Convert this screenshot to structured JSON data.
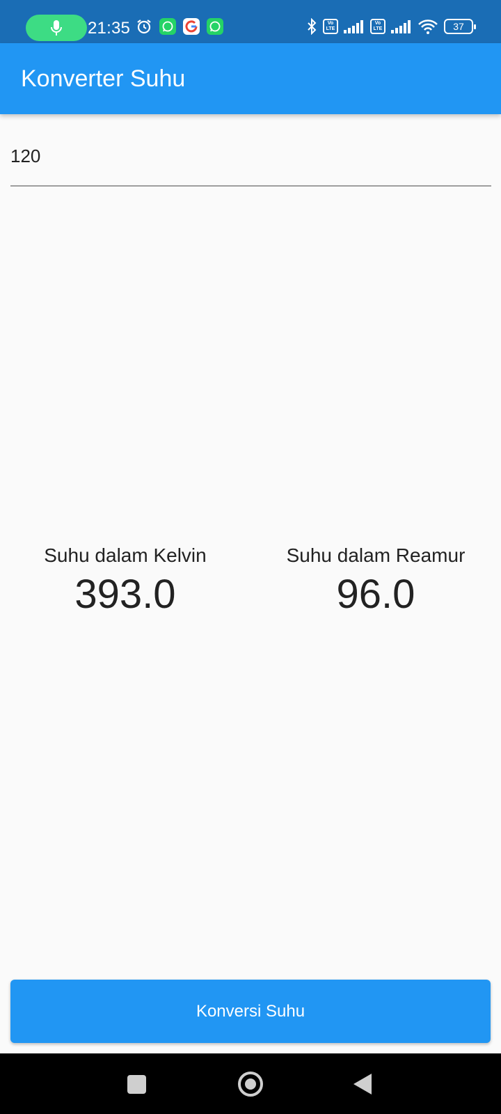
{
  "status_bar": {
    "time": "21:35",
    "battery_level": "37",
    "volte_label": "Vo LTE",
    "icons": [
      "mic-icon",
      "alarm-icon",
      "whatsapp-icon",
      "google-icon",
      "whatsapp-icon",
      "bluetooth-icon",
      "volte-icon",
      "signal-icon",
      "volte-icon",
      "signal-icon",
      "wifi-icon",
      "battery-icon"
    ]
  },
  "app_bar": {
    "title": "Konverter Suhu"
  },
  "input": {
    "value": "120"
  },
  "results": {
    "kelvin": {
      "label": "Suhu dalam Kelvin",
      "value": "393.0"
    },
    "reamur": {
      "label": "Suhu dalam Reamur",
      "value": "96.0"
    }
  },
  "convert_button": {
    "label": "Konversi Suhu"
  },
  "nav_bar": {
    "icons": [
      "recent-apps-icon",
      "home-icon",
      "back-icon"
    ]
  },
  "colors": {
    "status_bar": "#1a6db5",
    "primary": "#2196f3",
    "background": "#fafafa",
    "nav_bar": "#000000"
  }
}
